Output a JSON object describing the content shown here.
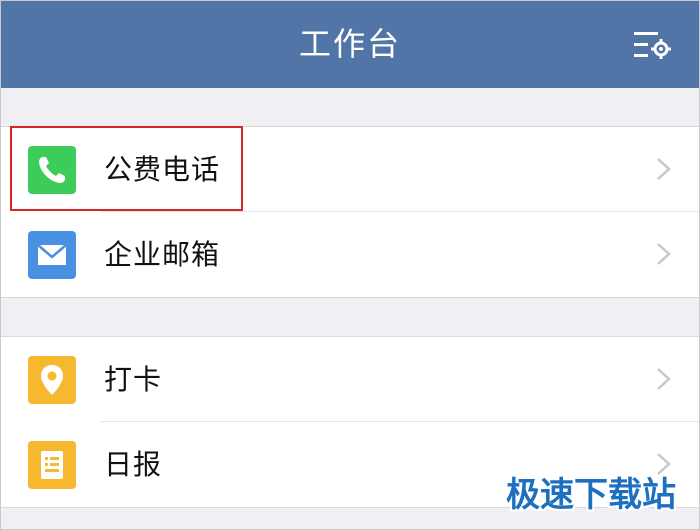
{
  "header": {
    "title": "工作台",
    "settings_icon": "settings-list-icon"
  },
  "groups": [
    {
      "items": [
        {
          "label": "公费电话",
          "icon": "phone-icon",
          "icon_bg": "#3dcb5a",
          "highlighted": true
        },
        {
          "label": "企业邮箱",
          "icon": "mail-icon",
          "icon_bg": "#4a90e2"
        }
      ]
    },
    {
      "items": [
        {
          "label": "打卡",
          "icon": "location-pin-icon",
          "icon_bg": "#f5b82e"
        },
        {
          "label": "日报",
          "icon": "report-document-icon",
          "icon_bg": "#f5b82e"
        }
      ]
    }
  ],
  "colors": {
    "header_bg": "#5275a8",
    "highlight_border": "#d6262a",
    "page_bg": "#efeff4"
  },
  "watermark": "极速下载站"
}
